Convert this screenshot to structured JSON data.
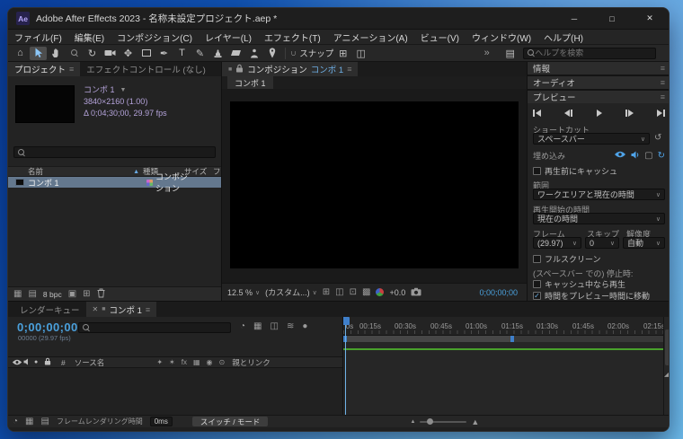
{
  "icons": {
    "app": "Ae",
    "minimize": "─",
    "maximize": "□",
    "close": "✕",
    "burger": "≡",
    "caret": "∨",
    "caret_down": "▼",
    "sort_asc": "▲",
    "chevrons": "»",
    "home": "⌂",
    "orbit": "↻",
    "pan": "✥",
    "pen": "✒",
    "text_tool": "T",
    "brush": "✎",
    "magnet": "∩",
    "workspace": "▤",
    "grid": "⊞",
    "mask": "◫",
    "roi": "⊡",
    "transparency": "▩",
    "reset": "↺",
    "loop": "↻",
    "frame_box": "▢",
    "check": "✓",
    "solo": "●",
    "square": "■",
    "mountain": "▲",
    "resize": "◢",
    "view_a": "◔",
    "view_b": "▦",
    "view_c": "◫",
    "view_d": "≋",
    "footer_a": "▦",
    "footer_b": "▤",
    "footer_c": "▣",
    "footer_d": "⊞"
  },
  "window": {
    "title": "Adobe After Effects 2023 - 名称未設定プロジェクト.aep *"
  },
  "menu": {
    "items": [
      "ファイル(F)",
      "編集(E)",
      "コンポジション(C)",
      "レイヤー(L)",
      "エフェクト(T)",
      "アニメーション(A)",
      "ビュー(V)",
      "ウィンドウ(W)",
      "ヘルプ(H)"
    ]
  },
  "toolbar": {
    "snap_label": "スナップ",
    "search_placeholder": "ヘルプを検索"
  },
  "project": {
    "tab_project": "プロジェクト",
    "tab_effects": "エフェクトコントロール (なし)",
    "comp_name": "コンポ 1",
    "comp_size": "3840×2160 (1.00)",
    "comp_duration": "Δ 0;04;30;00, 29.97 fps",
    "col_name": "名前",
    "col_type": "種類",
    "col_size": "サイズ",
    "col_extra": "フ",
    "row_name": "コンポ 1",
    "row_type": "コンポジション",
    "bpc": "8 bpc"
  },
  "comp": {
    "panel_title": "コンポジション",
    "viewer_name": "コンポ 1",
    "subtab": "コンポ 1",
    "zoom": "12.5 %",
    "resolution": "(カスタム...)",
    "exposure": "+0.0",
    "timecode": "0;00;00;00"
  },
  "right": {
    "info": "情報",
    "audio": "オーディオ",
    "preview": "プレビュー",
    "shortcut_label": "ショートカット",
    "shortcut_value": "スペースバー",
    "include_label": "埋め込み",
    "cache_before": "再生前にキャッシュ",
    "range_label": "範囲",
    "range_value": "ワークエリアと現在の時間",
    "play_from_label": "再生開始の時間",
    "play_from_value": "現在の時間",
    "frame_rate_label": "フレーム",
    "skip_label": "スキップ",
    "resolution_label": "解像度",
    "frame_rate_value": "(29.97)",
    "skip_value": "0",
    "resolution_value": "自動",
    "fullscreen": "フルスクリーン",
    "on_stop": "(スペースバー での) 停止時:",
    "play_cached": "キャッシュ中なら再生",
    "move_time": "時間をプレビュー時間に移動"
  },
  "timeline": {
    "tab_render_queue": "レンダーキュー",
    "tab_comp": "コンポ 1",
    "timecode": "0;00;00;00",
    "frames": "00000 (29.97 fps)",
    "hash": "#",
    "source_name": "ソース名",
    "parent_link": "親とリンク",
    "ruler": [
      "0s",
      "00:15s",
      "00:30s",
      "00:45s",
      "01:00s",
      "01:15s",
      "01:30s",
      "01:45s",
      "02:00s",
      "02:15s"
    ],
    "switch_icons": [
      "✦",
      "✶",
      "fx",
      "▦",
      "◉",
      "⊙"
    ],
    "render_time_label": "フレームレンダリング時間",
    "render_time_value": "0ms",
    "switch_mode": "スイッチ / モード"
  }
}
